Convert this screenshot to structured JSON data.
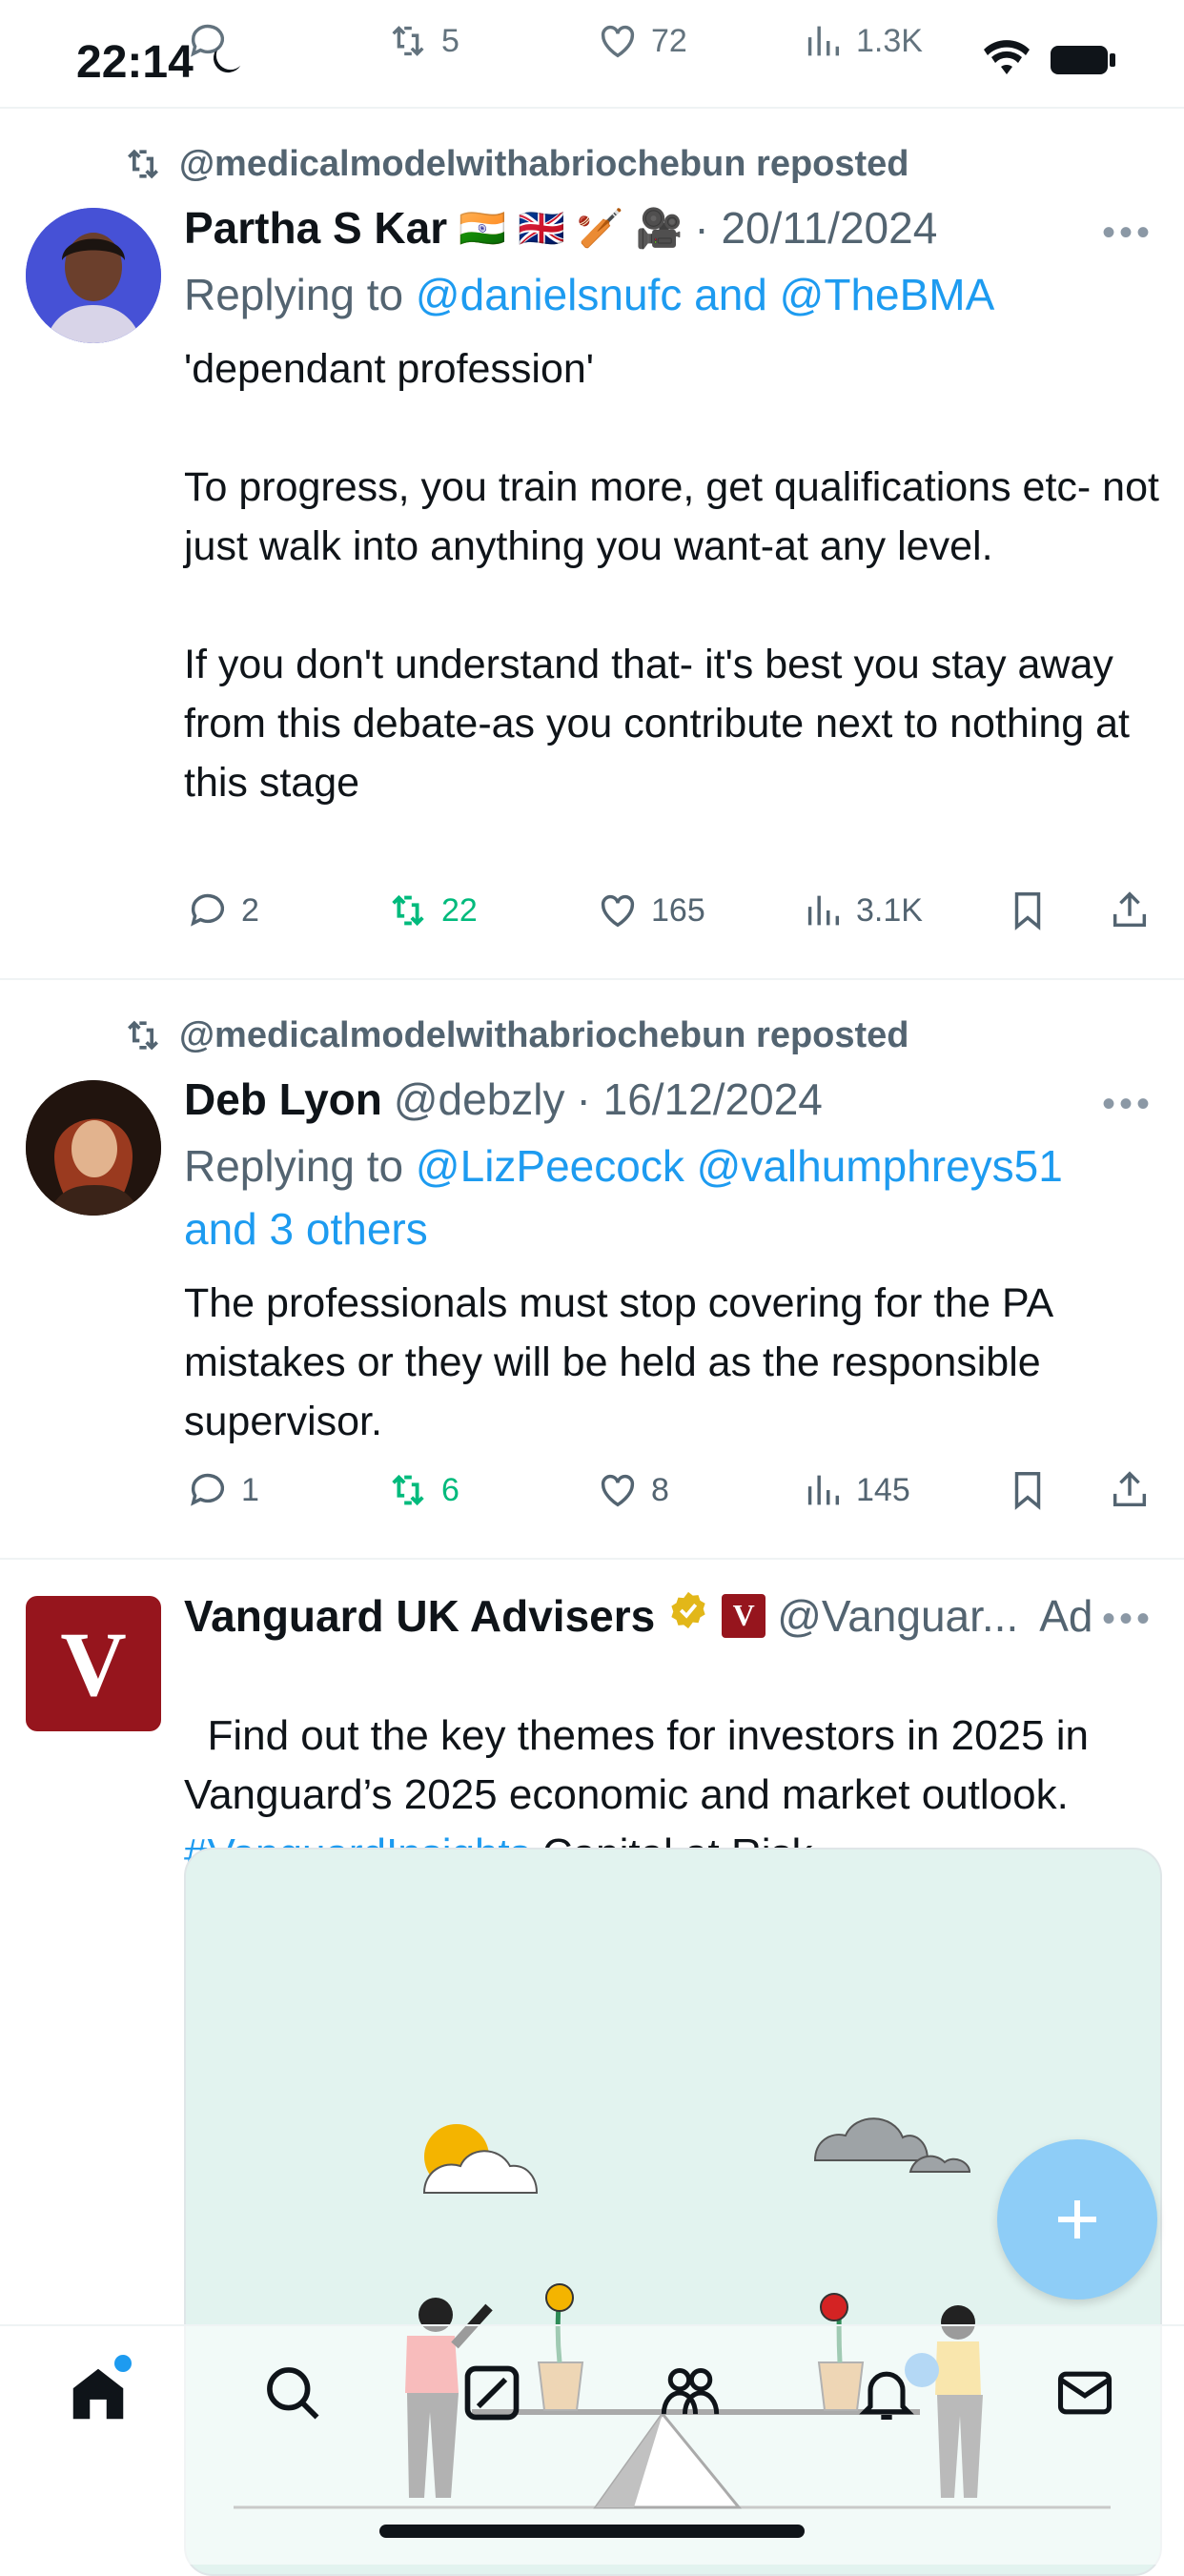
{
  "status_bar": {
    "time": "22:14"
  },
  "prev_tweet_actions": {
    "replies": "",
    "reposts": "5",
    "likes": "72",
    "views": "1.3K"
  },
  "tweets": [
    {
      "repost_text": "@medicalmodelwithabriochebun reposted",
      "name": "Partha S Kar",
      "emojis": [
        "🇮🇳",
        "🇬🇧",
        "🏏",
        "🎥"
      ],
      "date": "· 20/11/2024",
      "replying_prefix": "Replying to ",
      "replying_to": "@danielsnufc and @TheBMA",
      "text": "'dependant profession'\n\nTo progress, you train more, get qualifications etc- not just walk into anything you want-at any level.\n\nIf you don't understand that- it's best you stay away from this debate-as you contribute next to nothing at this stage",
      "replies": "2",
      "reposts": "22",
      "likes": "165",
      "views": "3.1K"
    },
    {
      "repost_text": "@medicalmodelwithabriochebun reposted",
      "name": "Deb Lyon",
      "handle": "@debzly",
      "date": "· 16/12/2024",
      "replying_prefix": "Replying to ",
      "replying_to_1": "@LizPeecock @valhumphreys51",
      "replying_to_2": "and 3 others",
      "text": "The professionals must stop covering for the PA mistakes or they will be held as the responsible supervisor.",
      "replies": "1",
      "reposts": "6",
      "likes": "8",
      "views": "145"
    }
  ],
  "ad": {
    "name": "Vanguard UK Advisers",
    "handle": "@Vanguar...",
    "ad_label": "Ad",
    "avatar_letter": "V",
    "text_part1": "Find out the key themes for investors in 2025 in Vanguard’s 2025 economic and market outlook. ",
    "hashtag": "#VanguardInsights",
    "text_part2": " Capital at Risk."
  },
  "nav": [
    "home",
    "search",
    "grok",
    "communities",
    "notifications",
    "messages"
  ],
  "colors": {
    "accent": "#1d9bf0",
    "repost_green": "#00ba7c",
    "vanguard_red": "#96151d",
    "fab": "#8ecdf7"
  }
}
